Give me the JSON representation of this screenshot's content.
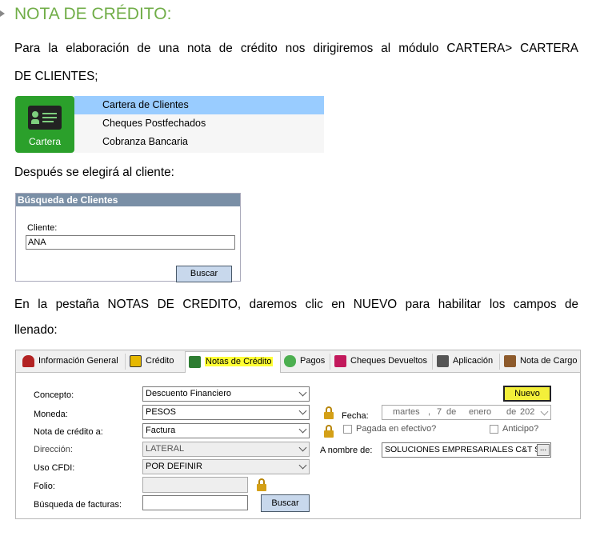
{
  "heading": "NOTA DE CRÉDITO:",
  "para1_line1": "Para la elaboración de una nota de crédito nos dirigiremos al módulo CARTERA> CARTERA",
  "para1_line2": "DE CLIENTES;",
  "cartera_menu": {
    "icon_label": "Cartera",
    "items": [
      "Cartera de Clientes",
      "Cheques Postfechados",
      "Cobranza Bancaria"
    ]
  },
  "para2": "Después se elegirá al cliente:",
  "busqueda": {
    "title": "Búsqueda de Clientes",
    "cliente_label": "Cliente:",
    "cliente_value": "ANA",
    "buscar_button": "Buscar"
  },
  "para3_line1": "En la pestaña NOTAS DE CREDITO, daremos clic en NUEVO para habilitar los campos de",
  "para3_line2": "llenado:",
  "tabs": [
    {
      "label": "Información General",
      "icon": "person-icon"
    },
    {
      "label": "Crédito",
      "icon": "calculator-icon"
    },
    {
      "label": "Notas de Crédito",
      "icon": "note-icon"
    },
    {
      "label": "Pagos",
      "icon": "coins-icon"
    },
    {
      "label": "Cheques Devueltos",
      "icon": "cheque-icon"
    },
    {
      "label": "Aplicación",
      "icon": "pen-icon"
    },
    {
      "label": "Nota de Cargo",
      "icon": "cargo-icon"
    }
  ],
  "form": {
    "concepto_label": "Concepto:",
    "concepto_value": "Descuento Financiero",
    "moneda_label": "Moneda:",
    "moneda_value": "PESOS",
    "nota_a_label": "Nota de crédito a:",
    "nota_a_value": "Factura",
    "direccion_label": "Dirección:",
    "direccion_value": "LATERAL",
    "uso_cfdi_label": "Uso CFDI:",
    "uso_cfdi_value": "POR DEFINIR",
    "folio_label": "Folio:",
    "busqueda_facturas_label": "Búsqueda de facturas:",
    "buscar_button": "Buscar",
    "nuevo_button": "Nuevo",
    "fecha_label": "Fecha:",
    "fecha_day_name": "martes",
    "fecha_day": "7",
    "fecha_de1": "de",
    "fecha_month": "enero",
    "fecha_de2": "de",
    "fecha_year": "202",
    "pagada_label": "Pagada en efectivo?",
    "anticipo_label": "Anticipo?",
    "a_nombre_label": "A nombre de:",
    "a_nombre_value": "SOLUCIONES EMPRESARIALES C&T S.A DE C.V.",
    "dots_label": "..."
  },
  "colors": {
    "heading": "#70AD47",
    "menu_selected": "#99CCFF",
    "highlight": "#FFFF33",
    "cartera_green": "#2BA02B"
  }
}
